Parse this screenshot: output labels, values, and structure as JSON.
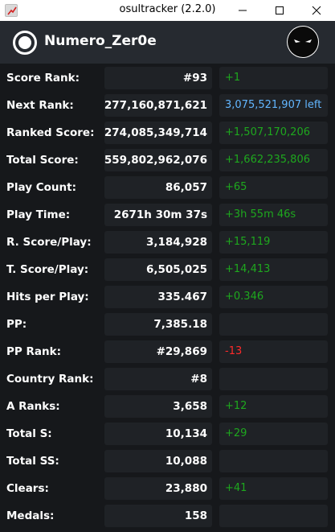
{
  "window": {
    "title": "osultracker (2.2.0)",
    "icon": "trend-chart-icon"
  },
  "profile": {
    "username": "Numero_Zer0e",
    "logo_icon": "osu-circle-logo-icon",
    "avatar_icon": "shadow-face-avatar-icon"
  },
  "colors": {
    "positive": "#1ea81e",
    "negative": "#ff2a2a",
    "info": "#62b6ff",
    "panel": "#1f2226",
    "header": "#262a30",
    "background": "#16181b"
  },
  "stats": [
    {
      "label": "Score Rank:",
      "value": "#93",
      "delta": "+1",
      "delta_type": "positive"
    },
    {
      "label": "Next Rank:",
      "value": "277,160,871,621",
      "delta": "3,075,521,907 left",
      "delta_type": "info"
    },
    {
      "label": "Ranked Score:",
      "value": "274,085,349,714",
      "delta": "+1,507,170,206",
      "delta_type": "positive"
    },
    {
      "label": "Total Score:",
      "value": "559,802,962,076",
      "delta": "+1,662,235,806",
      "delta_type": "positive"
    },
    {
      "label": "Play Count:",
      "value": "86,057",
      "delta": "+65",
      "delta_type": "positive"
    },
    {
      "label": "Play Time:",
      "value": "2671h 30m 37s",
      "delta": "+3h 55m 46s",
      "delta_type": "positive"
    },
    {
      "label": "R. Score/Play:",
      "value": "3,184,928",
      "delta": "+15,119",
      "delta_type": "positive"
    },
    {
      "label": "T. Score/Play:",
      "value": "6,505,025",
      "delta": "+14,413",
      "delta_type": "positive"
    },
    {
      "label": "Hits per Play:",
      "value": "335.467",
      "delta": "+0.346",
      "delta_type": "positive"
    },
    {
      "label": "PP:",
      "value": "7,385.18",
      "delta": "",
      "delta_type": "none"
    },
    {
      "label": "PP Rank:",
      "value": "#29,869",
      "delta": "-13",
      "delta_type": "negative"
    },
    {
      "label": "Country Rank:",
      "value": "#8",
      "delta": "",
      "delta_type": "none"
    },
    {
      "label": "A Ranks:",
      "value": "3,658",
      "delta": "+12",
      "delta_type": "positive"
    },
    {
      "label": "Total S:",
      "value": "10,134",
      "delta": "+29",
      "delta_type": "positive"
    },
    {
      "label": "Total SS:",
      "value": "10,088",
      "delta": "",
      "delta_type": "none"
    },
    {
      "label": "Clears:",
      "value": "23,880",
      "delta": "+41",
      "delta_type": "positive"
    },
    {
      "label": "Medals:",
      "value": "158",
      "delta": "",
      "delta_type": "none"
    }
  ]
}
